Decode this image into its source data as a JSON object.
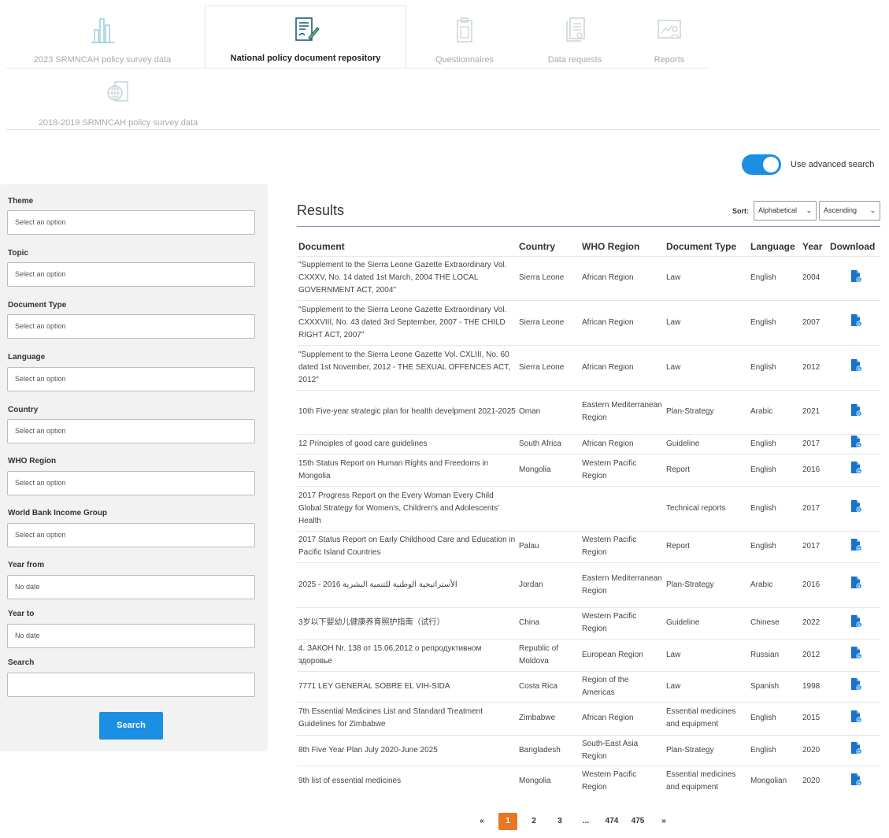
{
  "tabs": [
    {
      "label": "2023 SRMNCAH policy survey data",
      "icon": "bar-chart-icon"
    },
    {
      "label": "National policy document repository",
      "icon": "document-pen-icon"
    },
    {
      "label": "Questionnaires",
      "icon": "clipboard-icon"
    },
    {
      "label": "Data requests",
      "icon": "document-stack-icon"
    },
    {
      "label": "Reports",
      "icon": "report-chart-icon"
    },
    {
      "label": "2018-2019 SRMNCAH policy survey data",
      "icon": "globe-document-icon"
    }
  ],
  "advanced_search": {
    "label": "Use advanced search",
    "enabled": true
  },
  "filters": {
    "theme": {
      "label": "Theme",
      "placeholder": "Select an option"
    },
    "topic": {
      "label": "Topic",
      "placeholder": "Select an option"
    },
    "doc_type": {
      "label": "Document Type",
      "placeholder": "Select an option"
    },
    "language": {
      "label": "Language",
      "placeholder": "Select an option"
    },
    "country": {
      "label": "Country",
      "placeholder": "Select an option"
    },
    "who_region": {
      "label": "WHO Region",
      "placeholder": "Select an option"
    },
    "income": {
      "label": "World Bank Income Group",
      "placeholder": "Select an option"
    },
    "year_from": {
      "label": "Year from",
      "placeholder": "No date"
    },
    "year_to": {
      "label": "Year to",
      "placeholder": "No date"
    },
    "search": {
      "label": "Search",
      "value": ""
    },
    "button": "Search"
  },
  "results": {
    "title": "Results",
    "sort_label": "Sort:",
    "sort_by": "Alphabetical",
    "sort_order": "Ascending",
    "headers": [
      "Document",
      "Country",
      "WHO Region",
      "Document Type",
      "Language",
      "Year",
      "Download"
    ],
    "rows": [
      [
        "\"Supplement to the Sierra Leone Gazette Extraordinary Vol. CXXXV, No. 14 dated 1st March, 2004 THE LOCAL GOVERNMENT ACT, 2004\"",
        "Sierra Leone",
        "African Region",
        "Law",
        "English",
        "2004"
      ],
      [
        "\"Supplement to the Sierra Leone Gazette Extraordinary Vol. CXXXVIII, No. 43 dated 3rd September, 2007 - THE CHILD RIGHT ACT, 2007\"",
        "Sierra Leone",
        "African Region",
        "Law",
        "English",
        "2007"
      ],
      [
        "\"Supplement to the Sierra Leone Gazette Vol. CXLIII, No. 60 dated 1st November, 2012 - THE SEXUAL OFFENCES ACT, 2012\"",
        "Sierra Leone",
        "African Region",
        "Law",
        "English",
        "2012"
      ],
      [
        "10th Five-year strategic plan for health develpment 2021-2025",
        "Oman",
        "Eastern Mediterranean Region",
        "Plan-Strategy",
        "Arabic",
        "2021"
      ],
      [
        "12 Principles of good care guidelines",
        "South Africa",
        "African Region",
        "Guideline",
        "English",
        "2017"
      ],
      [
        "15th Status Report on Human Rights and Freedoms in Mongolia",
        "Mongolia",
        "Western Pacific Region",
        "Report",
        "English",
        "2016"
      ],
      [
        "2017 Progress Report on the Every Woman Every Child Global Strategy for Women's, Children's and Adolescents' Health",
        "",
        "",
        "Technical reports",
        "English",
        "2017"
      ],
      [
        "2017 Status Report on Early Childhood Care and Education in Pacific Island Countries",
        "Palau",
        "Western Pacific Region",
        "Report",
        "English",
        "2017"
      ],
      [
        "الأستراتيجية الوطنية للتنمية البشرية 2016 - 2025",
        "Jordan",
        "Eastern Mediterranean Region",
        "Plan-Strategy",
        "Arabic",
        "2016"
      ],
      [
        "3岁以下婴幼儿健康养育照护指南（试行）",
        "China",
        "Western Pacific Region",
        "Guideline",
        "Chinese",
        "2022"
      ],
      [
        "4. ЗАКОН Nr. 138 от 15.06.2012 о репродуктивном здоровье",
        "Republic of Moldova",
        "European Region",
        "Law",
        "Russian",
        "2012"
      ],
      [
        "7771 LEY GENERAL SOBRE EL VIH-SIDA",
        "Costa Rica",
        "Region of the Americas",
        "Law",
        "Spanish",
        "1998"
      ],
      [
        "7th Essential Medicines List and Standard Treatment Guidelines for Zimbabwe",
        "Zimbabwe",
        "African Region",
        "Essential medicines and equipment",
        "English",
        "2015"
      ],
      [
        "8th Five Year Plan July 2020-June 2025",
        "Bangladesh",
        "South-East Asia Region",
        "Plan-Strategy",
        "English",
        "2020"
      ],
      [
        "9th list of essential medicines",
        "Mongolia",
        "Western Pacific Region",
        "Essential medicines and equipment",
        "Mongolian",
        "2020"
      ]
    ]
  },
  "pagination": {
    "prev": "«",
    "pages": [
      "1",
      "2",
      "3",
      "...",
      "474",
      "475"
    ],
    "current": "1",
    "next": "»"
  },
  "colors": {
    "accent": "#1a8fe3",
    "page_active": "#e87722"
  }
}
